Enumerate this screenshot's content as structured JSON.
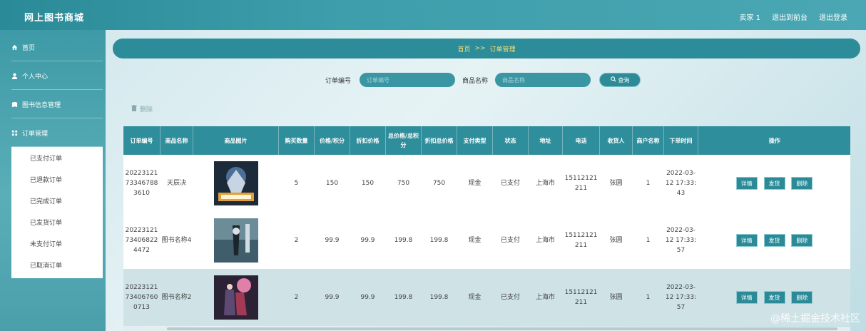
{
  "app": {
    "title": "网上图书商城"
  },
  "topnav": {
    "user": "卖家 1",
    "back_link": "退出到前台",
    "logout": "退出登录"
  },
  "sidebar": {
    "items": [
      {
        "label": "首页",
        "icon": "home-icon"
      },
      {
        "label": "个人中心",
        "icon": "user-icon"
      },
      {
        "label": "图书信息管理",
        "icon": "book-icon"
      },
      {
        "label": "订单管理",
        "icon": "grid-icon"
      }
    ],
    "submenu": [
      "已支付订单",
      "已退款订单",
      "已完成订单",
      "已发货订单",
      "未支付订单",
      "已取消订单"
    ]
  },
  "breadcrumb": {
    "home": "首页",
    "separator": ">>",
    "current": "订单管理"
  },
  "search": {
    "order_label": "订单编号",
    "order_placeholder": "订单编号",
    "name_label": "商品名称",
    "name_placeholder": "商品名称",
    "button": "查询"
  },
  "delete_label": "删除",
  "table": {
    "headers": [
      "订单编号",
      "商品名称",
      "商品图片",
      "购买数量",
      "价格/积分",
      "折扣价格",
      "总价格/总积分",
      "折扣总价格",
      "支付类型",
      "状态",
      "地址",
      "电话",
      "收货人",
      "商户名称",
      "下单时间",
      "操作"
    ],
    "rows": [
      {
        "order_no": "20223121733467883610",
        "name": "天辰决",
        "qty": "5",
        "price": "150",
        "discount": "150",
        "total": "750",
        "discount_total": "750",
        "pay": "现金",
        "status": "已支付",
        "addr": "上海市",
        "phone": "15112121211",
        "receiver": "张圆",
        "merchant": "1",
        "time": "2022-03-12 17:33:43",
        "cover": "cover-1"
      },
      {
        "order_no": "20223121734068224472",
        "name": "图书名称4",
        "qty": "2",
        "price": "99.9",
        "discount": "99.9",
        "total": "199.8",
        "discount_total": "199.8",
        "pay": "现金",
        "status": "已支付",
        "addr": "上海市",
        "phone": "15112121211",
        "receiver": "张圆",
        "merchant": "1",
        "time": "2022-03-12 17:33:57",
        "cover": "cover-2"
      },
      {
        "order_no": "20223121734067600713",
        "name": "图书名称2",
        "qty": "2",
        "price": "99.9",
        "discount": "99.9",
        "total": "199.8",
        "discount_total": "199.8",
        "pay": "现金",
        "status": "已支付",
        "addr": "上海市",
        "phone": "15112121211",
        "receiver": "张圆",
        "merchant": "1",
        "time": "2022-03-12 17:33:57",
        "cover": "cover-3"
      }
    ],
    "actions": [
      "详情",
      "发货",
      "删除"
    ]
  },
  "watermark": "@稀土掘金技术社区",
  "colors": {
    "primary": "#2d8c99",
    "accent": "#f6e07a",
    "header": "#2f8e9b"
  }
}
